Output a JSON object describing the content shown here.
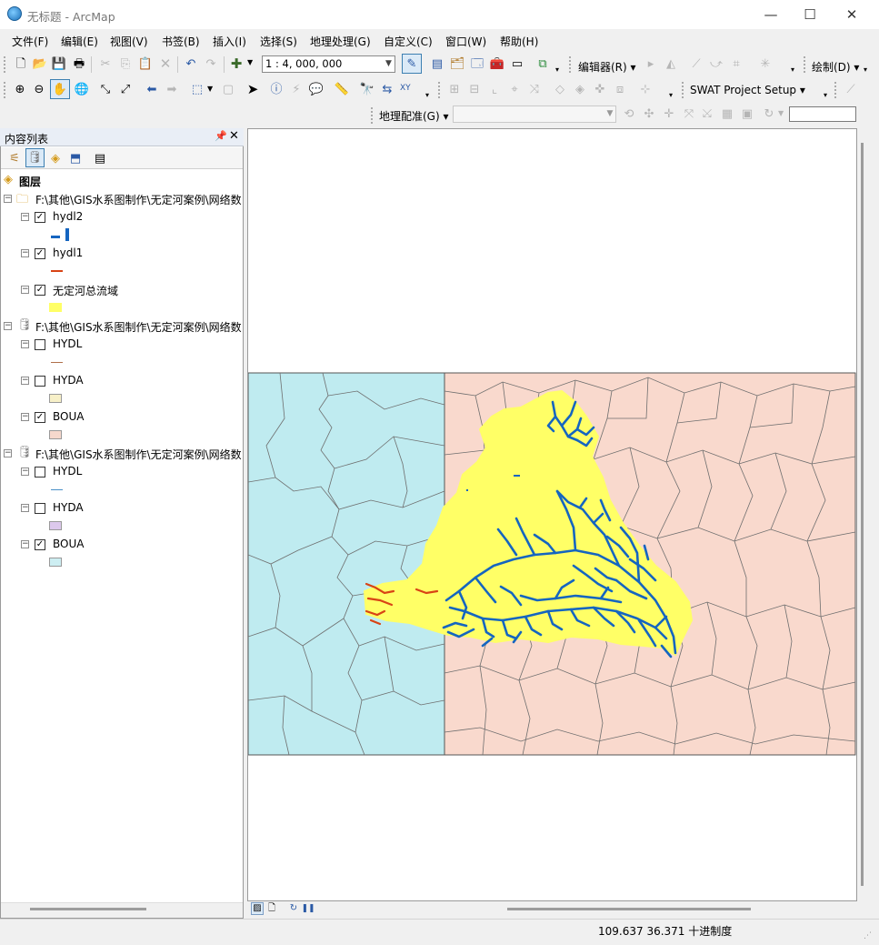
{
  "window": {
    "title": "无标题 - ArcMap",
    "controls": [
      "—",
      "☐",
      "✕"
    ]
  },
  "menu": [
    "文件(F)",
    "编辑(E)",
    "视图(V)",
    "书签(B)",
    "插入(I)",
    "选择(S)",
    "地理处理(G)",
    "自定义(C)",
    "窗口(W)",
    "帮助(H)"
  ],
  "toolbar": {
    "scale": "1 : 4, 000, 000",
    "editor_label": "编辑器(R)",
    "draw_label": "绘制(D)",
    "swat_label": "SWAT Project Setup",
    "georef_label": "地理配准(G)"
  },
  "toc": {
    "title": "内容列表",
    "root": "图层",
    "groups": [
      {
        "path": "F:\\其他\\GIS水系图制作\\无定河案例\\网络数",
        "icon": "folder-icon",
        "layers": [
          {
            "name": "hydl2",
            "checked": true,
            "symbol": "line",
            "color": "#1565c0"
          },
          {
            "name": "hydl1",
            "checked": true,
            "symbol": "line",
            "color": "#d84315"
          },
          {
            "name": "无定河总流域",
            "checked": true,
            "symbol": "fill",
            "color": "#ffff66"
          }
        ]
      },
      {
        "path": "F:\\其他\\GIS水系图制作\\无定河案例\\网络数",
        "icon": "database-icon",
        "layers": [
          {
            "name": "HYDL",
            "checked": false,
            "symbol": "line",
            "color": "#b0704a"
          },
          {
            "name": "HYDA",
            "checked": false,
            "symbol": "fill",
            "color": "#f7f0c8"
          },
          {
            "name": "BOUA",
            "checked": true,
            "symbol": "fill",
            "color": "#f6d8cc"
          }
        ]
      },
      {
        "path": "F:\\其他\\GIS水系图制作\\无定河案例\\网络数",
        "icon": "database-icon",
        "layers": [
          {
            "name": "HYDL",
            "checked": false,
            "symbol": "line",
            "color": "#4a90c8"
          },
          {
            "name": "HYDA",
            "checked": false,
            "symbol": "fill",
            "color": "#dcc8ec"
          },
          {
            "name": "BOUA",
            "checked": true,
            "symbol": "fill",
            "color": "#cdeef2"
          }
        ]
      }
    ]
  },
  "map": {
    "colors": {
      "west_province": "#bfebf0",
      "east_province": "#f9d9cd",
      "watershed": "#ffff66",
      "rivers": "#1565c0",
      "rivers_west": "#d84315",
      "boundary": "#707070"
    }
  },
  "status": {
    "coords": "109.637  36.371 十进制度"
  }
}
